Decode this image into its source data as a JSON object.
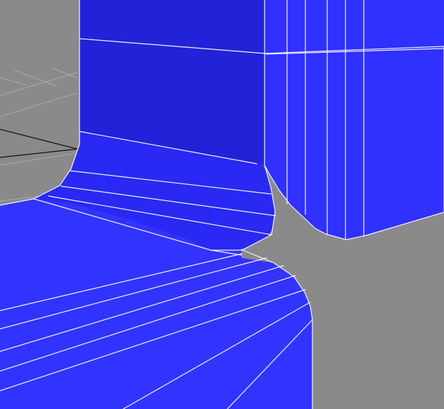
{
  "viewport": {
    "background": "#8a8a8a",
    "grid_color": "#b7b7b7",
    "axis_color": "#111111",
    "mesh": {
      "base_color": "#2b2bff",
      "dark_color": "#2222d8",
      "mid_color": "#2f2fff",
      "light_color": "#3a3aff",
      "edge_color": "#f2f2ff"
    }
  }
}
